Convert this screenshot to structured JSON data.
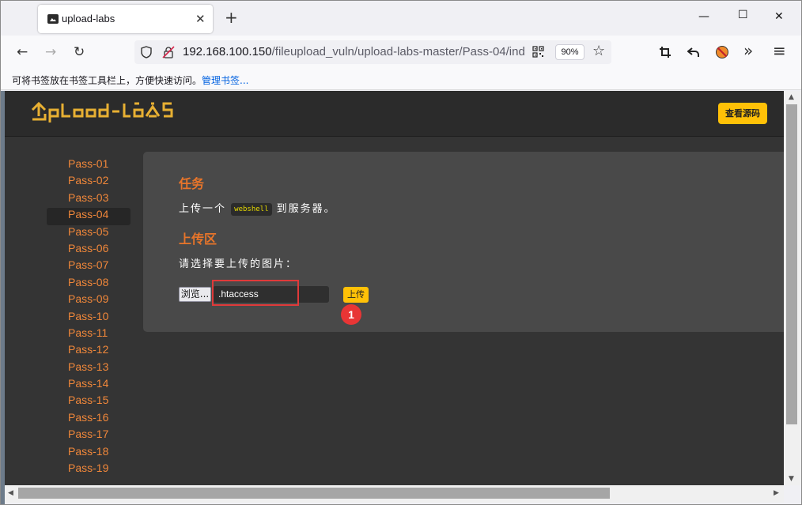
{
  "tab": {
    "title": "upload-labs",
    "close": "✕",
    "new_tab": "+"
  },
  "window_controls": {
    "minimize": "—",
    "maximize": "☐",
    "close": "✕"
  },
  "navbar": {
    "back": "←",
    "forward": "→",
    "reload": "↻",
    "url_host": "192.168.100.150",
    "url_path": "/fileupload_vuln/upload-labs-master/Pass-04/ind",
    "zoom": "90%",
    "star": "☆",
    "more_tools": "»",
    "menu": "≡"
  },
  "bookmarks_bar": {
    "hint": "可将书签放在书签工具栏上，方便快速访问。",
    "manage_link": "管理书签..."
  },
  "page": {
    "logo_text": "UpLoad-labs",
    "view_source_button": "查看源码",
    "sidebar": [
      "Pass-01",
      "Pass-02",
      "Pass-03",
      "Pass-04",
      "Pass-05",
      "Pass-06",
      "Pass-07",
      "Pass-08",
      "Pass-09",
      "Pass-10",
      "Pass-11",
      "Pass-12",
      "Pass-13",
      "Pass-14",
      "Pass-15",
      "Pass-16",
      "Pass-17",
      "Pass-18",
      "Pass-19"
    ],
    "active_pass": "Pass-04",
    "task_title": "任务",
    "task_text_before": "上传一个",
    "task_code": "webshell",
    "task_text_after": "到服务器。",
    "upload_title": "上传区",
    "upload_prompt": "请选择要上传的图片：",
    "browse_button": "浏览...",
    "file_name": ".htaccess",
    "upload_button": "上传",
    "step_marker": "1"
  },
  "colors": {
    "accent_orange": "#e8752a",
    "button_yellow": "#ffc107",
    "highlight_red": "#e03a3a"
  }
}
